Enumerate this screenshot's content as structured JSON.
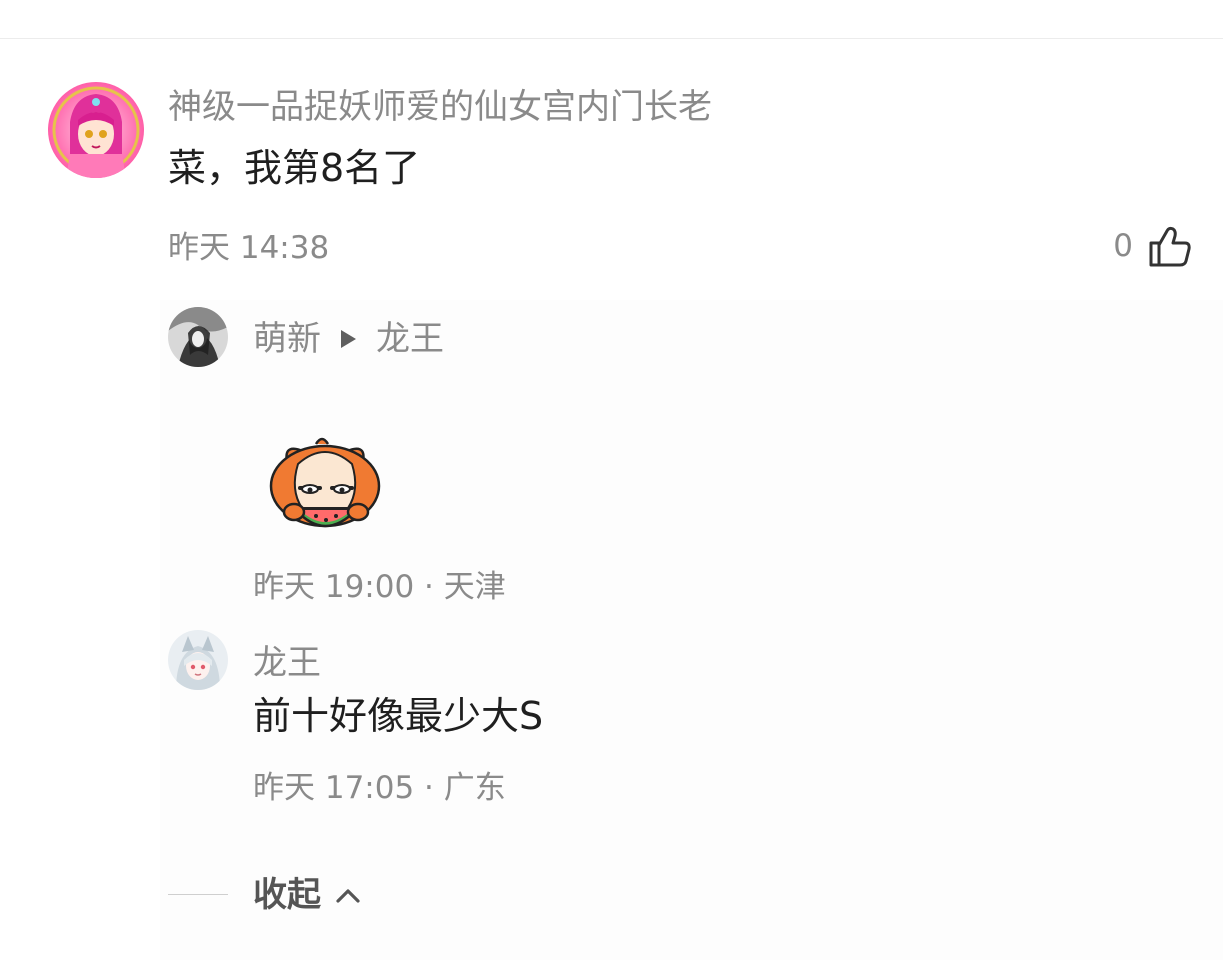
{
  "main_comment": {
    "username": "神级一品捉妖师爱的仙女宫内门长老",
    "content": "菜，我第8名了",
    "time": "昨天 14:38",
    "like_count": "0",
    "avatar_icon": "anime-girl-avatar"
  },
  "replies": [
    {
      "username": "萌新",
      "reply_to": "龙王",
      "sticker_icon": "watermelon-eating-cat-sticker",
      "time": "昨天 19:00",
      "location": "天津",
      "meta": "昨天 19:00 · 天津"
    },
    {
      "username": "龙王",
      "content": "前十好像最少大S",
      "time": "昨天 17:05",
      "location": "广东",
      "meta": "昨天 17:05 · 广东"
    }
  ],
  "collapse": {
    "label": "收起"
  },
  "colors": {
    "meta_text": "#8a8a8a",
    "body_text": "#1f1f1f",
    "collapse_text": "#555555",
    "sticker_orange": "#f07a32"
  }
}
